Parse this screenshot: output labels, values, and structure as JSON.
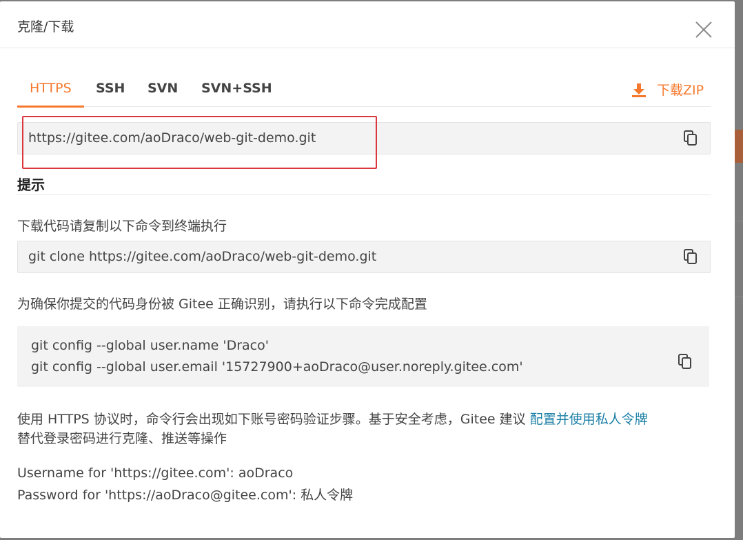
{
  "modal": {
    "title": "克隆/下载"
  },
  "tabs": [
    {
      "label": "HTTPS",
      "active": true
    },
    {
      "label": "SSH",
      "active": false
    },
    {
      "label": "SVN",
      "active": false
    },
    {
      "label": "SVN+SSH",
      "active": false
    }
  ],
  "download_zip": "下载ZIP",
  "clone_url": "https://gitee.com/aoDraco/web-git-demo.git",
  "hint": {
    "title": "提示",
    "download_instruction": "下载代码请复制以下命令到终端执行",
    "clone_command": "git clone https://gitee.com/aoDraco/web-git-demo.git",
    "identity_instruction": "为确保你提交的代码身份被 Gitee 正确识别，请执行以下命令完成配置",
    "config_name": "git config --global user.name 'Draco'",
    "config_email": "git config --global user.email '15727900+aoDraco@user.noreply.gitee.com'",
    "https_note_prefix": "使用 HTTPS 协议时，命令行会出现如下账号密码验证步骤。基于安全考虑，Gitee 建议",
    "https_note_link": "配置并使用私人令牌",
    "https_note_suffix": "替代登录密码进行克隆、推送等操作",
    "username_line": "Username for 'https://gitee.com': aoDraco",
    "password_line": "Password for 'https://aoDraco@gitee.com': 私人令牌"
  },
  "colors": {
    "accent": "#f5782c",
    "link": "#1a7fa6",
    "highlight": "#d9363e"
  }
}
